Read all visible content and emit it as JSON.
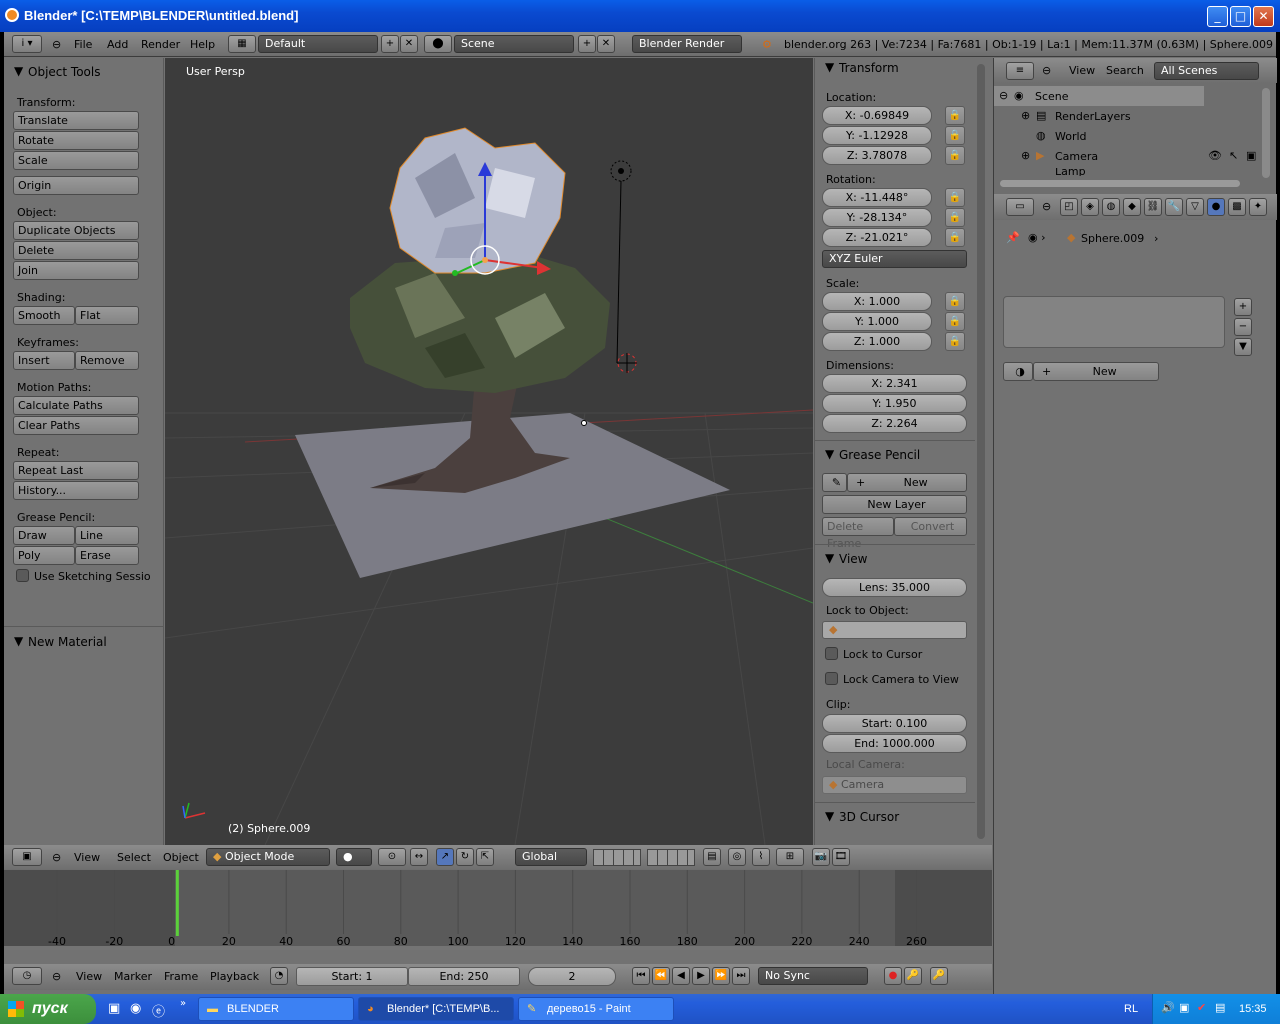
{
  "window": {
    "title": "Blender* [C:\\TEMP\\BLENDER\\untitled.blend]"
  },
  "topbar": {
    "menus": [
      "File",
      "Add",
      "Render",
      "Help"
    ],
    "layout": "Default",
    "scene": "Scene",
    "engine": "Blender Render",
    "stats": "blender.org 263 | Ve:7234 | Fa:7681 | Ob:1-19 | La:1 | Mem:11.37M (0.63M) | Sphere.009"
  },
  "tools": {
    "header": "Object Tools",
    "transform_label": "Transform:",
    "translate": "Translate",
    "rotate": "Rotate",
    "scale": "Scale",
    "origin": "Origin",
    "object_label": "Object:",
    "duplicate": "Duplicate Objects",
    "delete": "Delete",
    "join": "Join",
    "shading_label": "Shading:",
    "smooth": "Smooth",
    "flat": "Flat",
    "keyframes_label": "Keyframes:",
    "insert": "Insert",
    "remove": "Remove",
    "motion_label": "Motion Paths:",
    "calc_paths": "Calculate Paths",
    "clear_paths": "Clear Paths",
    "repeat_label": "Repeat:",
    "repeat_last": "Repeat Last",
    "history": "History...",
    "grease_label": "Grease Pencil:",
    "draw": "Draw",
    "line": "Line",
    "poly": "Poly",
    "erase": "Erase",
    "sketching": "Use Sketching Sessio",
    "new_material": "New Material"
  },
  "viewport": {
    "view_name": "User Persp",
    "object_name": "(2) Sphere.009"
  },
  "properties": {
    "transform": "Transform",
    "location": "Location:",
    "loc_x": "X: -0.69849",
    "loc_y": "Y: -1.12928",
    "loc_z": "Z: 3.78078",
    "rotation": "Rotation:",
    "rot_x": "X: -11.448°",
    "rot_y": "Y: -28.134°",
    "rot_z": "Z: -21.021°",
    "rot_mode": "XYZ Euler",
    "scale": "Scale:",
    "sc_x": "X: 1.000",
    "sc_y": "Y: 1.000",
    "sc_z": "Z: 1.000",
    "dimensions": "Dimensions:",
    "dim_x": "X: 2.341",
    "dim_y": "Y: 1.950",
    "dim_z": "Z: 2.264",
    "grease_pencil": "Grease Pencil",
    "gp_new": "New",
    "new_layer": "New Layer",
    "delete_frame": "Delete Frame",
    "convert": "Convert",
    "view": "View",
    "lens": "Lens: 35.000",
    "lock_to_object": "Lock to Object:",
    "lock_to_cursor": "Lock to Cursor",
    "lock_camera": "Lock Camera to View",
    "clip": "Clip:",
    "clip_start": "Start: 0.100",
    "clip_end": "End: 1000.000",
    "local_camera": "Local Camera:",
    "camera": "Camera",
    "cursor": "3D Cursor"
  },
  "outliner": {
    "view": "View",
    "search": "Search",
    "filter": "All Scenes",
    "scene": "Scene",
    "render_layers": "RenderLayers",
    "world": "World",
    "camera": "Camera",
    "lamp": "Lamp"
  },
  "props_editor": {
    "object": "Sphere.009",
    "new": "New"
  },
  "viewport_header": {
    "menus": [
      "View",
      "Select",
      "Object"
    ],
    "mode": "Object Mode",
    "orientation": "Global"
  },
  "timeline": {
    "ticks": [
      "-40",
      "-20",
      "0",
      "20",
      "40",
      "60",
      "80",
      "100",
      "120",
      "140",
      "160",
      "180",
      "200",
      "220",
      "240",
      "260"
    ],
    "current_frame": 2,
    "menus": [
      "View",
      "Marker",
      "Frame",
      "Playback"
    ],
    "start": "Start: 1",
    "end": "End: 250",
    "frame": "2",
    "sync": "No Sync"
  },
  "taskbar": {
    "start": "пуск",
    "tasks": [
      "BLENDER",
      "Blender* [C:\\TEMP\\B...",
      "дерево15 - Paint"
    ],
    "lang": "RL",
    "clock": "15:35"
  }
}
